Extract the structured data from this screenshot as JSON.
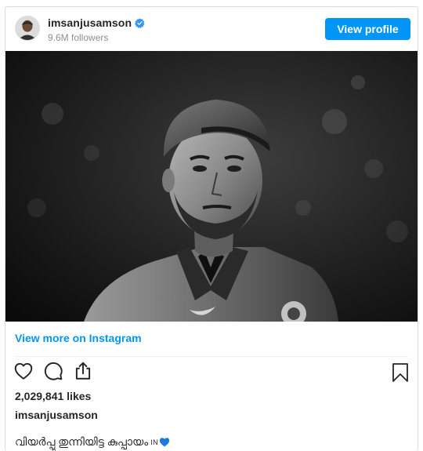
{
  "header": {
    "username": "imsanjusamson",
    "followers": "9.6M followers",
    "view_profile_label": "View profile"
  },
  "post": {
    "view_more_label": "View more on Instagram",
    "likes": "2,029,841 likes",
    "caption_username": "imsanjusamson",
    "caption_text": "വിയർപ്പു തുന്നിയിട്ട കുപ്പായം",
    "caption_suffix": "IN"
  },
  "icons": {
    "verified": "verified-badge-icon",
    "like": "heart-icon",
    "comment": "comment-icon",
    "share": "share-icon",
    "save": "bookmark-icon",
    "caption_emoji": "blue-heart-icon"
  },
  "colors": {
    "accent": "#0095f6",
    "text": "#262626",
    "muted": "#8e8e8e",
    "border": "#dbdbdb"
  }
}
